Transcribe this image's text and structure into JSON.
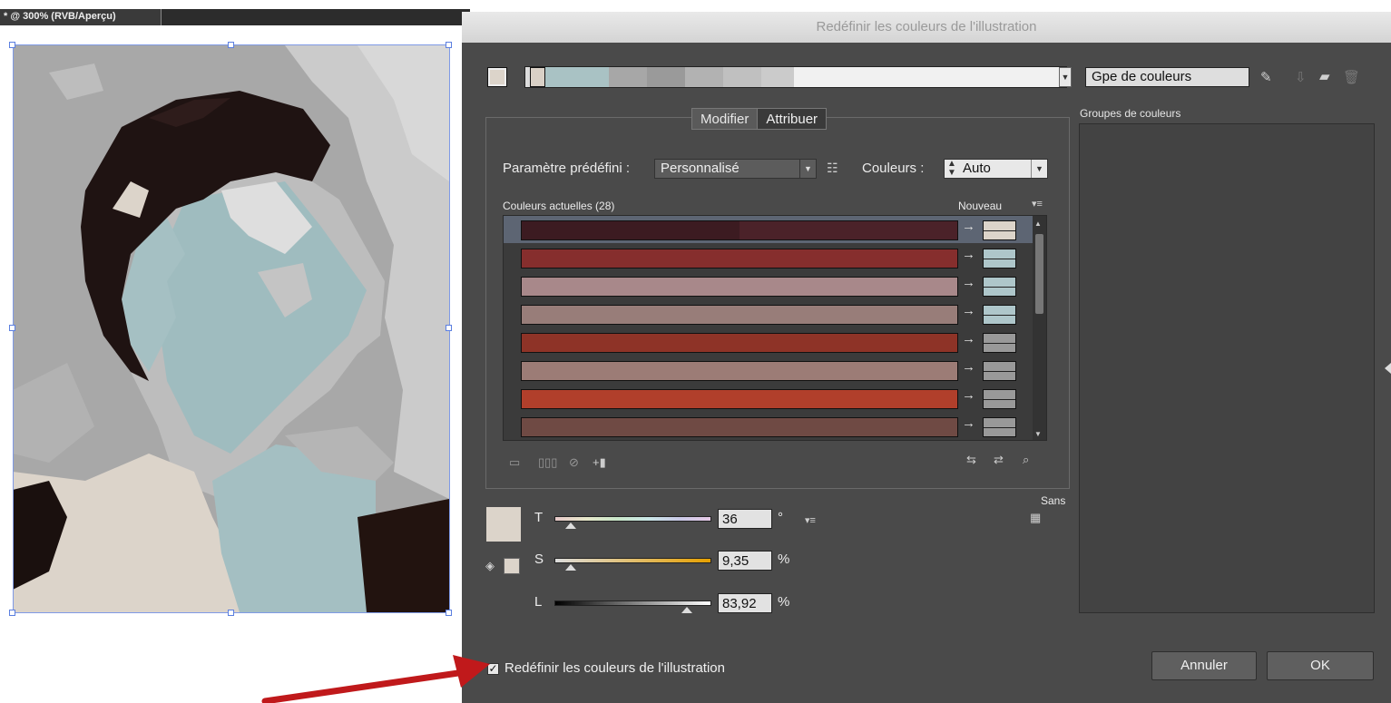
{
  "document": {
    "tab_title": "* @ 300% (RVB/Aperçu)"
  },
  "dialog": {
    "title": "Redéfinir les couleurs de l'illustration",
    "harmony_colors": [
      "#d9d0c6",
      "#a9c2c4",
      "#a7a7a7",
      "#9a9a9a",
      "#b2b2b2",
      "#c0c0c0",
      "#cbcbcb",
      "#f1f1f1"
    ],
    "color_group_name": "Gpe de couleurs",
    "groups_label": "Groupes de couleurs",
    "tabs": [
      {
        "label": "Modifier",
        "active": true
      },
      {
        "label": "Attribuer",
        "active": false
      }
    ],
    "preset_label": "Paramètre prédéfini :",
    "preset_value": "Personnalisé",
    "colors_label": "Couleurs :",
    "colors_value": "Auto",
    "current_colors_label": "Couleurs actuelles (28)",
    "new_label": "Nouveau",
    "color_rows": [
      {
        "current": [
          "#3c1b21",
          "#4b2229"
        ],
        "new_color": "#dcd4ca",
        "selected": true
      },
      {
        "current": [
          "#862e2d"
        ],
        "new_color": "#aec6ca",
        "selected": false
      },
      {
        "current": [
          "#a8888a"
        ],
        "new_color": "#aec6ca",
        "selected": false
      },
      {
        "current": [
          "#987d79"
        ],
        "new_color": "#aec6ca",
        "selected": false
      },
      {
        "current": [
          "#8e3327"
        ],
        "new_color": "#999999",
        "selected": false
      },
      {
        "current": [
          "#9c7c76"
        ],
        "new_color": "#999999",
        "selected": false
      },
      {
        "current": [
          "#b13f2b"
        ],
        "new_color": "#999999",
        "selected": false
      },
      {
        "current": [
          "#6f4a44"
        ],
        "new_color": "#999999",
        "selected": false
      }
    ],
    "none_label": "Sans",
    "sliders": [
      {
        "label": "T",
        "value": "36",
        "unit": "°",
        "knob_fraction": 0.1
      },
      {
        "label": "S",
        "value": "9,35",
        "unit": "%",
        "knob_fraction": 0.1
      },
      {
        "label": "L",
        "value": "83,92",
        "unit": "%",
        "knob_fraction": 0.84
      }
    ],
    "recolor_checkbox_label": "Redéfinir les couleurs de l'illustration",
    "recolor_checked": true,
    "cancel_label": "Annuler",
    "ok_label": "OK",
    "checkmark": "✓"
  },
  "icons": {
    "eyedropper": "eyedropper-icon",
    "save": "save-group-icon",
    "folder": "new-folder-icon",
    "trash": "trash-icon"
  },
  "colors": {
    "dialog_bg": "#4a4a4a",
    "selection_blue": "#7f9ae6",
    "arrow_red": "#c0191b"
  }
}
